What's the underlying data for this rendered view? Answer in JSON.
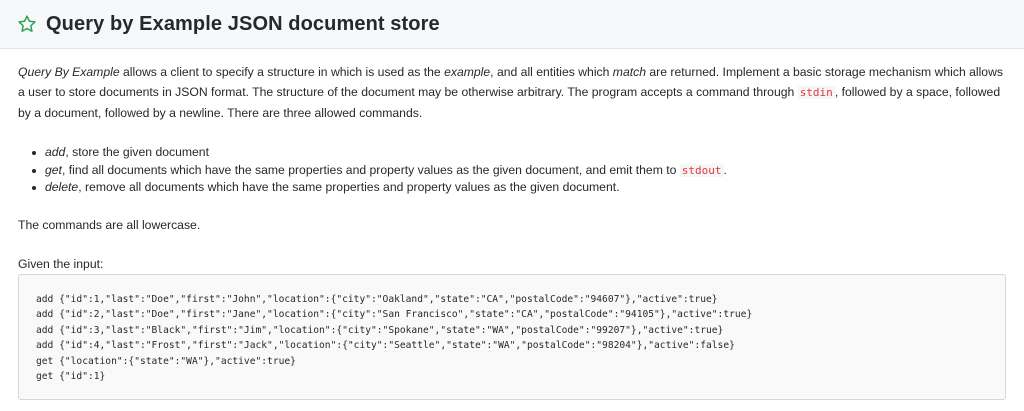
{
  "header": {
    "title": "Query by Example JSON document store",
    "star_icon": "star-outline-icon",
    "star_color": "#2da44e"
  },
  "intro": {
    "t1": "Query By Example",
    "t2": " allows a client to specify a structure in which is used as the ",
    "t3": "example",
    "t4": ", and all entities which ",
    "t5": "match",
    "t6": " are returned. Implement a basic storage mechanism which allows a user to store documents in JSON format. The structure of the document may be otherwise arbitrary. The program accepts a command through ",
    "code_stdin": "stdin",
    "t7": ", followed by a space, followed by a document, followed by a newline. There are three allowed commands."
  },
  "commands": [
    {
      "name": "add",
      "desc": ", store the given document"
    },
    {
      "name": "get",
      "desc": ", find all documents which have the same properties and property values as the given document, and emit them to ",
      "code": "stdout",
      "tail": "."
    },
    {
      "name": "delete",
      "desc": ", remove all documents which have the same properties and property values as the given document."
    }
  ],
  "lowercase_note": "The commands are all lowercase.",
  "given_input_label": "Given the input:",
  "code_lines": [
    "add {\"id\":1,\"last\":\"Doe\",\"first\":\"John\",\"location\":{\"city\":\"Oakland\",\"state\":\"CA\",\"postalCode\":\"94607\"},\"active\":true}",
    "add {\"id\":2,\"last\":\"Doe\",\"first\":\"Jane\",\"location\":{\"city\":\"San Francisco\",\"state\":\"CA\",\"postalCode\":\"94105\"},\"active\":true}",
    "add {\"id\":3,\"last\":\"Black\",\"first\":\"Jim\",\"location\":{\"city\":\"Spokane\",\"state\":\"WA\",\"postalCode\":\"99207\"},\"active\":true}",
    "add {\"id\":4,\"last\":\"Frost\",\"first\":\"Jack\",\"location\":{\"city\":\"Seattle\",\"state\":\"WA\",\"postalCode\":\"98204\"},\"active\":false}",
    "get {\"location\":{\"state\":\"WA\"},\"active\":true}",
    "get {\"id\":1}"
  ]
}
